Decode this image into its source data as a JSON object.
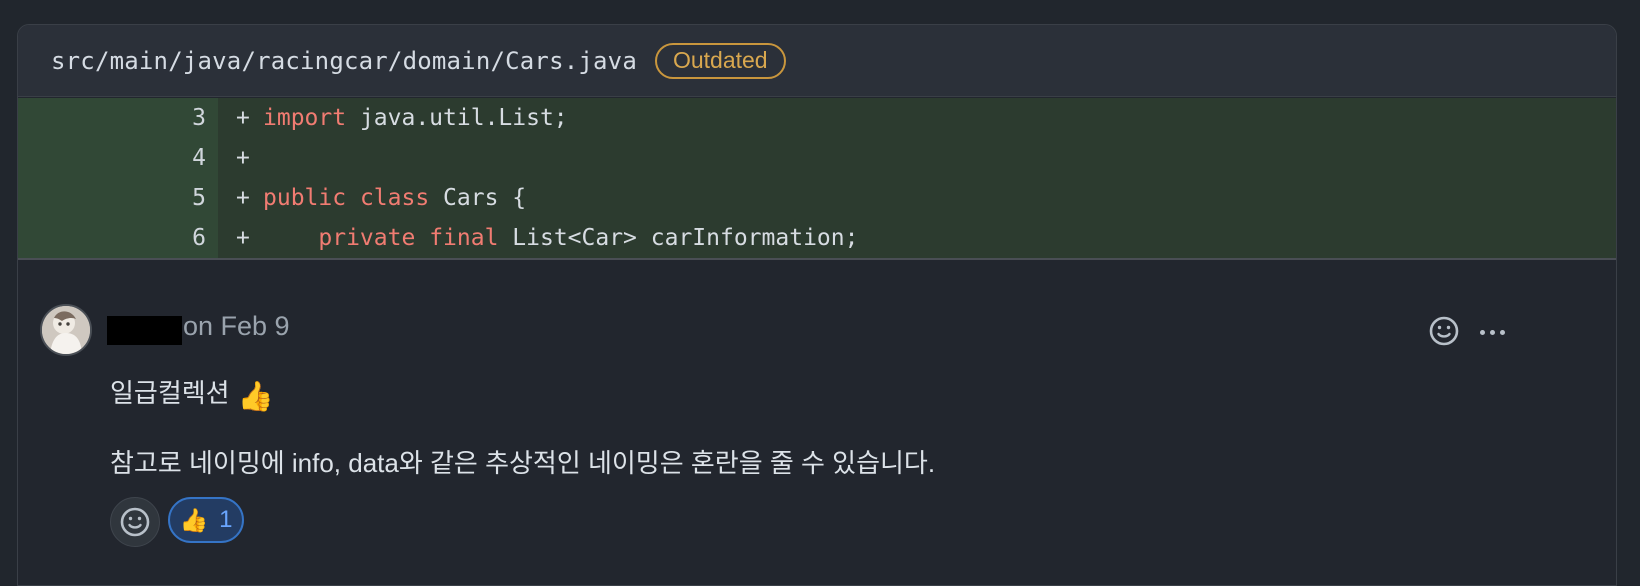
{
  "file_header": {
    "path": "src/main/java/racingcar/domain/Cars.java",
    "badge": "Outdated"
  },
  "diff": {
    "rows": [
      {
        "line": "3",
        "sign": "+",
        "tokens": [
          {
            "text": "import",
            "kind": "keyword"
          },
          {
            "text": " java.util.List;",
            "kind": "plain"
          }
        ]
      },
      {
        "line": "4",
        "sign": "+",
        "tokens": []
      },
      {
        "line": "5",
        "sign": "+",
        "tokens": [
          {
            "text": "public",
            "kind": "keyword"
          },
          {
            "text": " ",
            "kind": "plain"
          },
          {
            "text": "class",
            "kind": "keyword"
          },
          {
            "text": " Cars {",
            "kind": "plain"
          }
        ]
      },
      {
        "line": "6",
        "sign": "+",
        "tokens": [
          {
            "text": "    ",
            "kind": "plain"
          },
          {
            "text": "private",
            "kind": "keyword"
          },
          {
            "text": " ",
            "kind": "plain"
          },
          {
            "text": "final",
            "kind": "keyword"
          },
          {
            "text": " List<Car> carInformation;",
            "kind": "plain"
          }
        ]
      }
    ]
  },
  "comment": {
    "date": "on Feb 9",
    "line_1": "일급컬렉션",
    "line_1_emoji": "👍",
    "line_2": "참고로 네이밍에 info, data와 같은 추상적인 네이밍은 혼란을 줄 수 있습니다."
  },
  "reaction": {
    "emoji": "👍",
    "count": "1"
  },
  "icons": {
    "comment_reaction": "smiley-icon",
    "more": "more-horizontal-icon",
    "picker": "smiley-icon"
  },
  "colors": {
    "diff_added_background": "#2c3b2f",
    "diff_gutter_background": "#314836",
    "keyword": "#f17c72",
    "badge": "#d9a84f",
    "reaction_border": "#3574c6"
  }
}
